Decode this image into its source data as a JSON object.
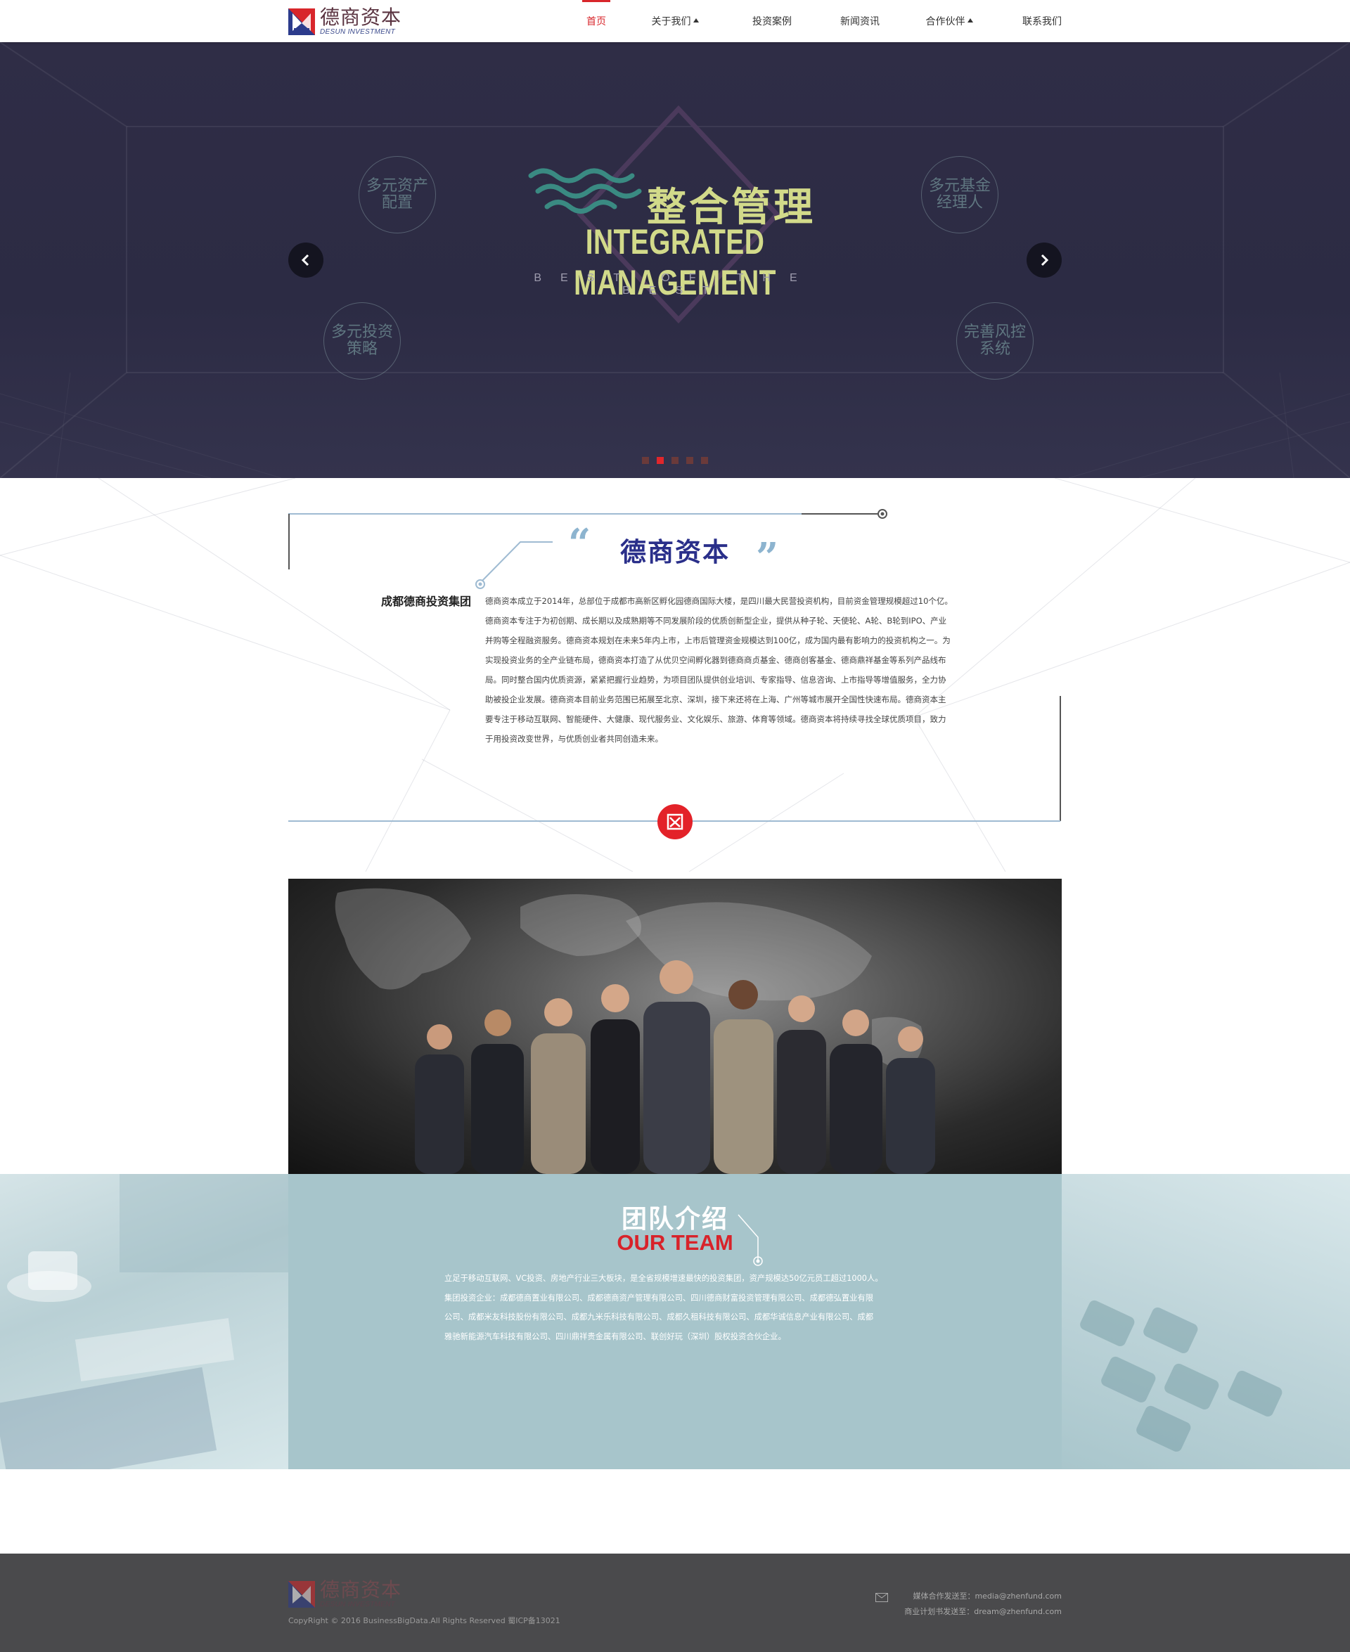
{
  "header": {
    "logo": {
      "cn": "德商资本",
      "en": "DESUN INVESTMENT"
    },
    "nav": [
      {
        "label": "首页",
        "active": true,
        "has_caret": false
      },
      {
        "label": "关于我们",
        "active": false,
        "has_caret": true
      },
      {
        "label": "投资案例",
        "active": false,
        "has_caret": false
      },
      {
        "label": "新闻资讯",
        "active": false,
        "has_caret": false
      },
      {
        "label": "合作伙伴",
        "active": false,
        "has_caret": true
      },
      {
        "label": "联系我们",
        "active": false,
        "has_caret": false
      }
    ]
  },
  "banner": {
    "title_cn": "整合管理",
    "title_en": "INTEGRATED MANAGEMENT",
    "subtitle": "BEST OF THE BEST",
    "circles": [
      {
        "line1": "多元资产",
        "line2": "配置"
      },
      {
        "line1": "多元基金",
        "line2": "经理人"
      },
      {
        "line1": "多元投资",
        "line2": "策略"
      },
      {
        "line1": "完善风控",
        "line2": "系统"
      }
    ],
    "slide_count": 5,
    "active_slide": 2
  },
  "intro": {
    "title": "德商资本",
    "open_quote": "“",
    "close_quote": "”",
    "left_label": "成都德商投资集团",
    "lines": [
      "德商资本成立于2014年，总部位于成都市高新区孵化园德商国际大楼，是四川最大民营投资机构，目前资金管理规模超过10个亿。",
      "德商资本专注于为初创期、成长期以及成熟期等不同发展阶段的优质创新型企业，提供从种子轮、天使轮、A轮、B轮到IPO、产业",
      "并购等全程融资服务。德商资本规划在未来5年内上市，上市后管理资金规模达到100亿，成为国内最有影响力的投资机构之一。为",
      "实现投资业务的全产业链布局，德商资本打造了从优贝空间孵化器到德商商贞基金、德商创客基金、德商鼎祥基金等系列产品线布",
      "局。同时整合国内优质资源，紧紧把握行业趋势，为项目团队提供创业培训、专家指导、信息咨询、上市指导等增值服务，全力协",
      "助被投企业发展。德商资本目前业务范围已拓展至北京、深圳，接下来还将在上海、广州等城市展开全国性快速布局。德商资本主",
      "要专注于移动互联网、智能硬件、大健康、现代服务业、文化娱乐、旅游、体育等领域。德商资本将持续寻找全球优质项目，致力",
      "于用投资改变世界，与优质创业者共同创造未来。"
    ]
  },
  "team": {
    "title_cn": "团队介绍",
    "title_en": "OUR TEAM",
    "lines": [
      "立足于移动互联网、VC投资、房地产行业三大板块，是全省规模增速最快的投资集团，资产规模达50亿元员工超过1000人。",
      "集团投资企业：成都德商置业有限公司、成都德商资产管理有限公司、四川德商财富投资管理有限公司、成都德弘置业有限",
      "公司、成都米友科技股份有限公司、成都九米乐科技有限公司、成都久租科技有限公司、成都华诚信息产业有限公司、成都",
      "雅驰新能源汽车科技有限公司、四川鼎祥贵金属有限公司、联创好玩（深圳）股权投资合伙企业。"
    ]
  },
  "footer": {
    "logo": {
      "cn": "德商资本",
      "en": "DESUN INVESTMENT"
    },
    "copyright": "CopyRight © 2016 BusinessBigData.All Rights Reserved 蜀ICP备13021",
    "media_contact": "媒体合作发送至：media@zhenfund.com",
    "plan_contact": "商业计划书发送至：dream@zhenfund.com"
  },
  "colors": {
    "accent_red": "#d8262b",
    "banner_bg": "#2d2c45",
    "banner_title": "#d2da8a",
    "brand_blue": "#2a2f8a",
    "team_band": "#a7c5cb",
    "footer_bg": "#4a4a4c"
  }
}
